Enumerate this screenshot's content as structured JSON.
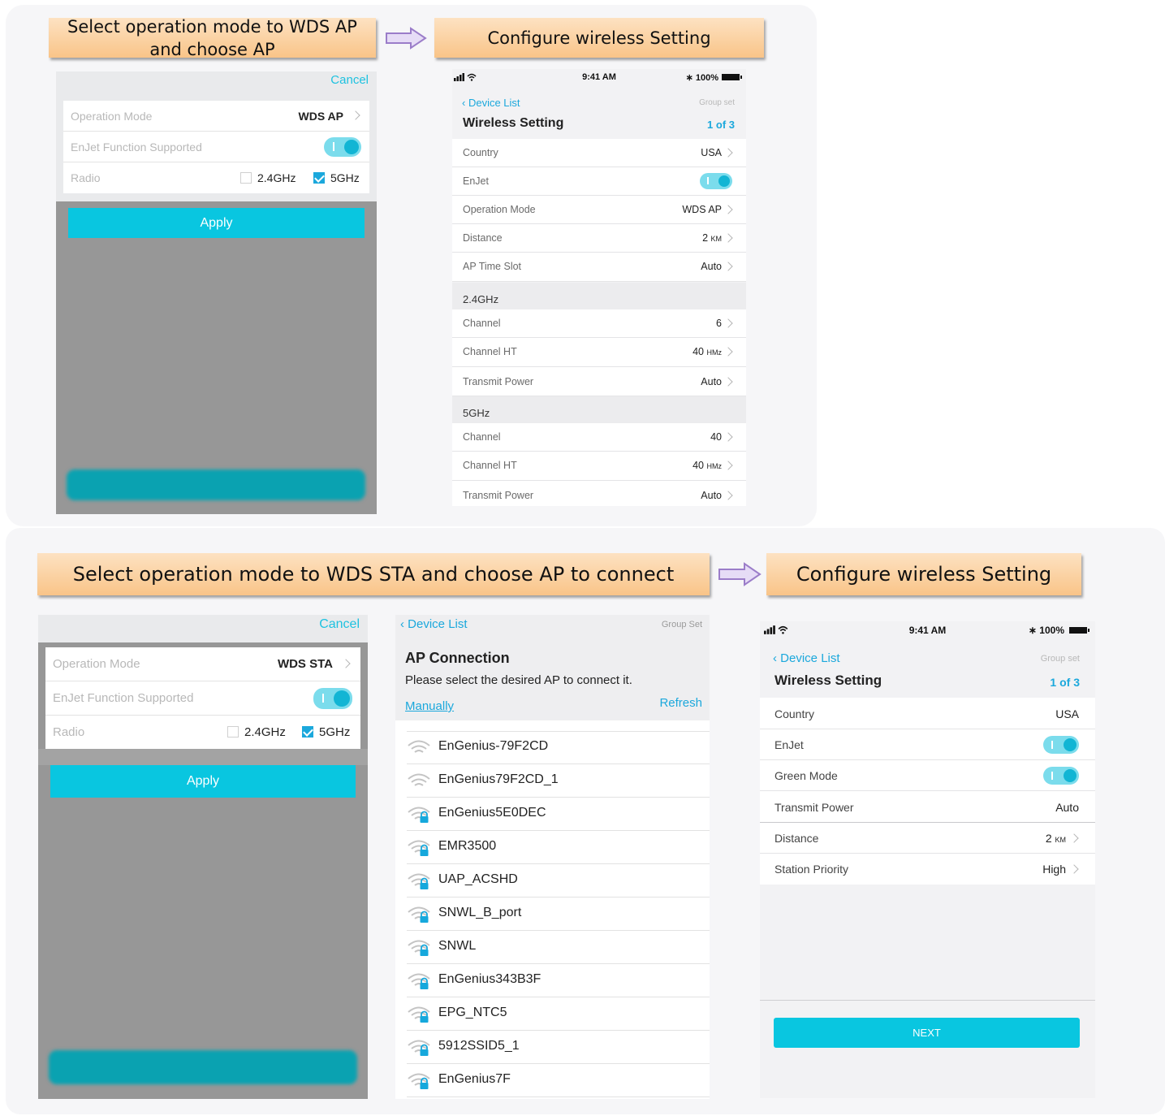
{
  "top_section": {
    "banner_left": "Select operation mode to WDS AP and choose AP",
    "banner_right": "Configure wireless Setting",
    "dialog": {
      "cancel": "Cancel",
      "rows": [
        {
          "label": "Operation Mode",
          "value": "WDS AP"
        },
        {
          "label": "EnJet Function Supported"
        },
        {
          "label": "Radio",
          "opt1": "2.4GHz",
          "opt2": "5GHz"
        }
      ],
      "apply": "Apply",
      "enjet_on": true,
      "radio_24_checked": false,
      "radio_5_checked": true
    },
    "phone": {
      "time": "9:41 AM",
      "battery": "100%",
      "back": "Device List",
      "group_set": "Group set",
      "title": "Wireless Setting",
      "page_count": "1 of 3",
      "rows": [
        {
          "label": "Country",
          "value": "USA"
        },
        {
          "label": "EnJet"
        },
        {
          "label": "Operation Mode",
          "value": "WDS AP"
        },
        {
          "label": "Distance",
          "value": "2",
          "unit": "KM"
        },
        {
          "label": "AP Time Slot",
          "value": "Auto"
        }
      ],
      "section_24": "2.4GHz",
      "rows_24": [
        {
          "label": "Channel",
          "value": "6"
        },
        {
          "label": "Channel HT",
          "value": "40",
          "unit": "HMz"
        },
        {
          "label": "Transmit Power",
          "value": "Auto"
        }
      ],
      "section_5": "5GHz",
      "rows_5": [
        {
          "label": "Channel",
          "value": "40"
        },
        {
          "label": "Channel HT",
          "value": "40",
          "unit": "HMz"
        },
        {
          "label": "Transmit Power",
          "value": "Auto"
        }
      ]
    }
  },
  "bottom_section": {
    "banner_left": "Select operation mode to WDS STA and choose AP to connect",
    "banner_right": "Configure wireless Setting",
    "dialog": {
      "cancel": "Cancel",
      "rows": [
        {
          "label": "Operation Mode",
          "value": "WDS STA"
        },
        {
          "label": "EnJet Function Supported"
        },
        {
          "label": "Radio",
          "opt1": "2.4GHz",
          "opt2": "5GHz"
        }
      ],
      "apply": "Apply"
    },
    "ap_connection": {
      "back": "Device List",
      "group_set": "Group Set",
      "title": "AP Connection",
      "subtitle": "Please select the desired AP to connect it.",
      "manually": "Manually",
      "refresh": "Refresh",
      "networks": [
        {
          "name": "EnGenius-79F2CD",
          "secured": false
        },
        {
          "name": "EnGenius79F2CD_1",
          "secured": false
        },
        {
          "name": "EnGenius5E0DEC",
          "secured": true
        },
        {
          "name": "EMR3500",
          "secured": true
        },
        {
          "name": "UAP_ACSHD",
          "secured": true
        },
        {
          "name": "SNWL_B_port",
          "secured": true
        },
        {
          "name": "SNWL",
          "secured": true
        },
        {
          "name": "EnGenius343B3F",
          "secured": true
        },
        {
          "name": "EPG_NTC5",
          "secured": true
        },
        {
          "name": "5912SSID5_1",
          "secured": true
        },
        {
          "name": "EnGenius7F",
          "secured": true
        }
      ]
    },
    "phone": {
      "time": "9:41 AM",
      "battery": "100%",
      "back": "Device List",
      "group_set": "Group set",
      "title": "Wireless Setting",
      "page_count": "1 of 3",
      "rows": [
        {
          "label": "Country",
          "value": "USA"
        },
        {
          "label": "EnJet"
        },
        {
          "label": "Green Mode"
        },
        {
          "label": "Transmit Power",
          "value": "Auto"
        },
        {
          "label": "Distance",
          "value": "2",
          "unit": "KM"
        },
        {
          "label": "Station Priority",
          "value": "High"
        }
      ],
      "next": "NEXT"
    }
  },
  "colors": {
    "accent": "#09c6e0",
    "link": "#1ba8dc",
    "banner_top": "#fde2c2",
    "banner_bottom": "#f9c488",
    "arrow_fill": "#e6dcf6",
    "arrow_stroke": "#9b7dc9"
  }
}
